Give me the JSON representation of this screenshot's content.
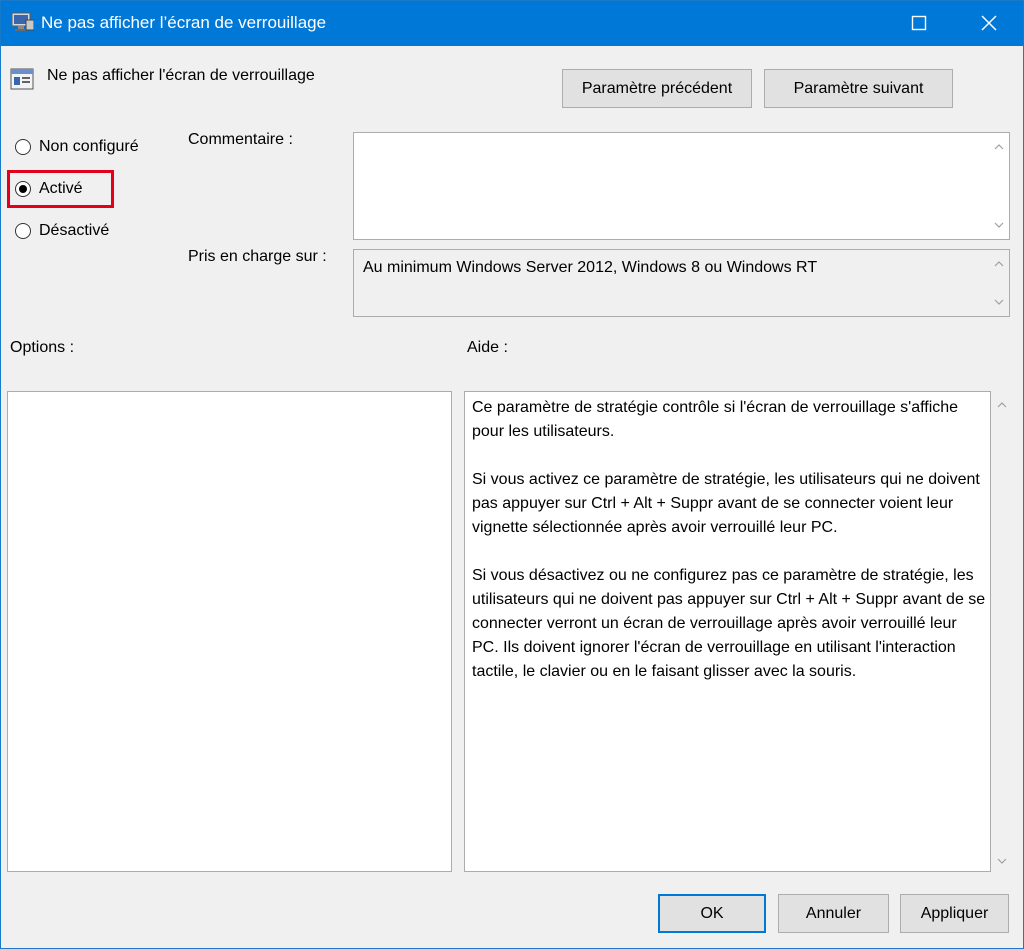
{
  "window": {
    "title": "Ne pas afficher l’écran de verrouillage",
    "accent": "#0078d7"
  },
  "policy": {
    "name": "Ne pas afficher l'écran de verrouillage"
  },
  "nav": {
    "prev_label": "Paramètre précédent",
    "next_label": "Paramètre suivant"
  },
  "state": {
    "options": [
      {
        "label": "Non configuré",
        "checked": false
      },
      {
        "label": "Activé",
        "checked": true
      },
      {
        "label": "Désactivé",
        "checked": false
      }
    ],
    "highlight_color": "#e3001b"
  },
  "comment": {
    "label": "Commentaire :",
    "value": ""
  },
  "supported": {
    "label": "Pris en charge sur :",
    "value": "Au minimum Windows Server 2012, Windows 8 ou Windows RT"
  },
  "options_panel": {
    "label": "Options :"
  },
  "help_panel": {
    "label": "Aide :",
    "paragraphs": [
      "Ce paramètre de stratégie contrôle si l'écran de verrouillage s'affiche pour les utilisateurs.",
      "Si vous activez ce paramètre de stratégie, les utilisateurs qui ne doivent pas appuyer sur Ctrl + Alt + Suppr avant de se connecter voient leur vignette sélectionnée après avoir verrouillé leur PC.",
      "Si vous désactivez ou ne configurez pas ce paramètre de stratégie, les utilisateurs qui ne doivent pas appuyer sur Ctrl + Alt + Suppr avant de se connecter verront un écran de verrouillage après avoir verrouillé leur PC. Ils doivent ignorer l'écran de verrouillage en utilisant l'interaction tactile, le clavier ou en le faisant glisser avec la souris."
    ]
  },
  "footer": {
    "ok_label": "OK",
    "cancel_label": "Annuler",
    "apply_label": "Appliquer"
  },
  "icons": {
    "title": "policy-settings-icon",
    "maximize": "maximize-icon",
    "close": "close-icon"
  }
}
